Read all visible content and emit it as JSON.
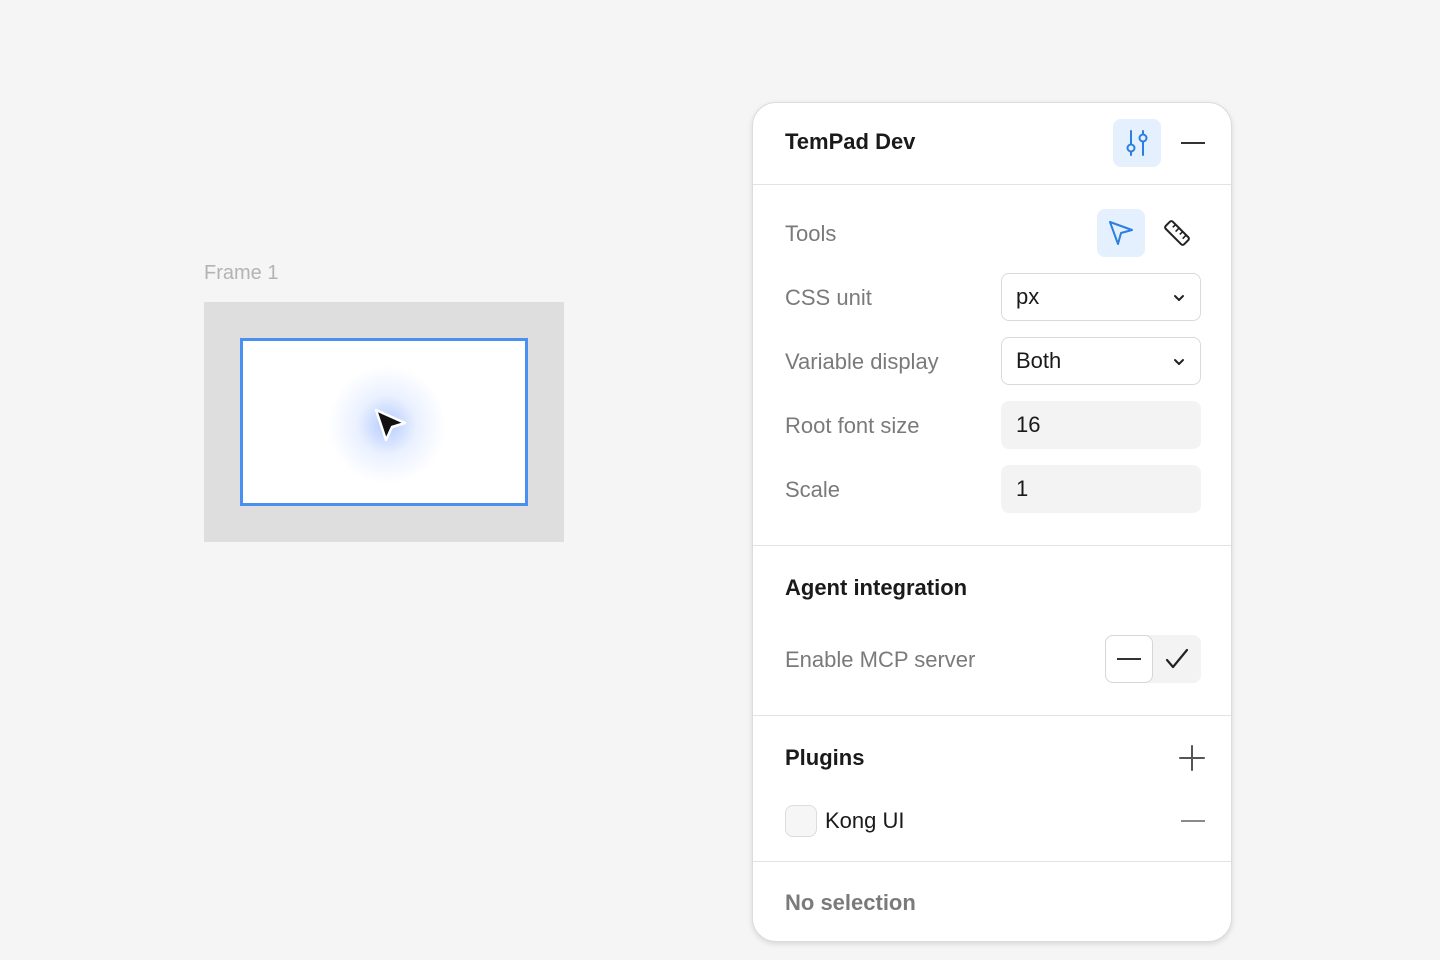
{
  "canvas": {
    "frame_label": "Frame 1"
  },
  "panel": {
    "title": "TemPad Dev",
    "header_buttons": {
      "preferences_icon": "sliders-icon",
      "minimize_icon": "minus-icon"
    },
    "preferences": {
      "tools": {
        "label": "Tools",
        "items": [
          {
            "icon": "cursor-arrow-icon",
            "active": true
          },
          {
            "icon": "ruler-icon",
            "active": false
          }
        ]
      },
      "css_unit": {
        "label": "CSS unit",
        "value": "px"
      },
      "variable_display": {
        "label": "Variable display",
        "value": "Both"
      },
      "root_font_size": {
        "label": "Root font size",
        "value": "16"
      },
      "scale": {
        "label": "Scale",
        "value": "1"
      }
    },
    "agent_integration": {
      "title": "Agent integration",
      "enable_mcp": {
        "label": "Enable MCP server",
        "selected": "off"
      }
    },
    "plugins": {
      "title": "Plugins",
      "items": [
        {
          "name": "Kong UI",
          "checked": false
        }
      ]
    },
    "status": "No selection"
  },
  "colors": {
    "accent": "#4a90f0",
    "accent_bg": "#e4f0fd",
    "canvas_bg": "#f5f5f5",
    "frame_fill": "#dedede"
  }
}
